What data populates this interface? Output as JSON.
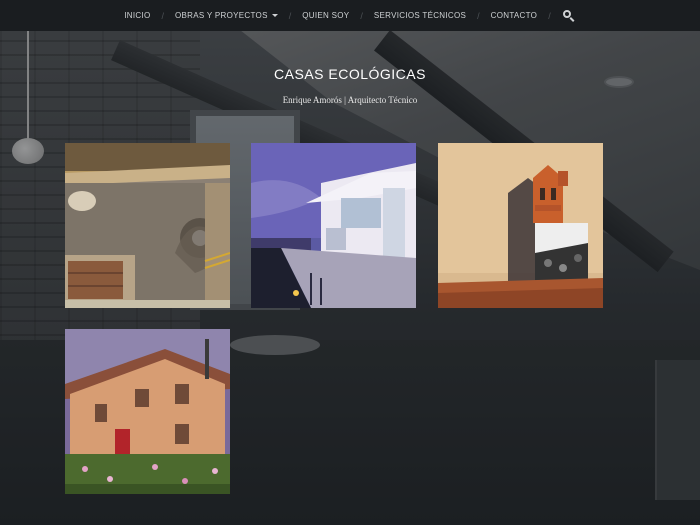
{
  "nav": {
    "items": [
      {
        "label": "INICIO",
        "dropdown": false
      },
      {
        "label": "OBRAS Y PROYECTOS",
        "dropdown": true
      },
      {
        "label": "QUIEN SOY",
        "dropdown": false
      },
      {
        "label": "SERVICIOS TÉCNICOS",
        "dropdown": false
      },
      {
        "label": "CONTACTO",
        "dropdown": false
      }
    ],
    "search_icon": "search-icon"
  },
  "header": {
    "title": "CASAS ECOLÓGICAS",
    "subtitle": "Enrique Amorós | Arquitecto Técnico"
  },
  "gallery": {
    "images": [
      {
        "subject": "earthen wall interior with wooden door and circular window"
      },
      {
        "subject": "modern white house with glass facade and pool at dusk"
      },
      {
        "subject": "ceramic chimney caps against a warm wall"
      },
      {
        "subject": "two-storey ochre house with red door and flowering field"
      }
    ]
  },
  "colors": {
    "navbar_bg": "#1a1d20",
    "nav_text": "#cfd2d4",
    "title_text": "#ffffff"
  }
}
